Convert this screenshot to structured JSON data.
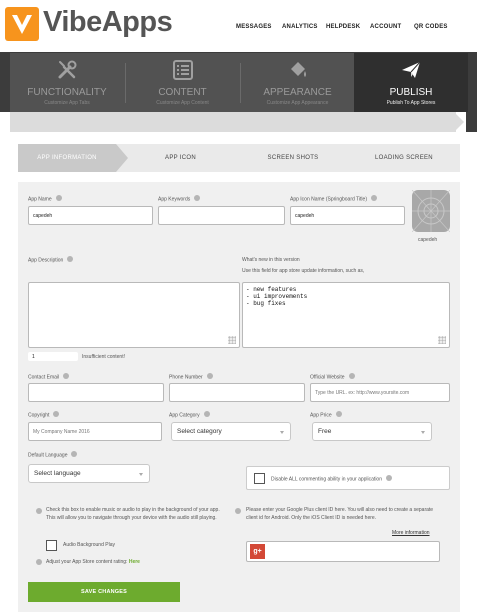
{
  "brand": {
    "name": "VibeApps",
    "logo_color": "#f7941d"
  },
  "topnav": [
    "MESSAGES",
    "ANALYTICS",
    "HELPDESK",
    "ACCOUNT",
    "QR CODES"
  ],
  "sections": [
    {
      "title": "FUNCTIONALITY",
      "sub": "Customize App Tabs",
      "icon": "tools-icon"
    },
    {
      "title": "CONTENT",
      "sub": "Customize App Content",
      "icon": "list-icon"
    },
    {
      "title": "APPEARANCE",
      "sub": "Customize App Appearance",
      "icon": "paint-bucket-icon"
    },
    {
      "title": "PUBLISH",
      "sub": "Publish To App Stores",
      "icon": "paper-plane-icon",
      "active": true
    }
  ],
  "steps": [
    "APP INFORMATION",
    "APP ICON",
    "SCREEN SHOTS",
    "LOADING SCREEN"
  ],
  "form": {
    "app_name_label": "App Name",
    "app_name_value": "capedeh",
    "app_keywords_label": "App Keywords",
    "app_keywords_value": "",
    "icon_name_label": "App Icon Name (Springboard Title)",
    "icon_name_value": "capedeh",
    "icon_caption": "capedeh",
    "description_label": "App Description",
    "whats_new_label": "What's new in this version",
    "whats_new_hint": "Use this field for app store update information, such as,",
    "whats_new_value": "- new features\n- ui improvements\n- bug fixes",
    "char_count": "1",
    "char_status": "Insufficient content!",
    "contact_email_label": "Contact Email",
    "phone_label": "Phone Number",
    "website_label": "Official Website",
    "website_placeholder": "Type the URL. ex: http://www.yoursite.com",
    "copyright_label": "Copyright",
    "copyright_placeholder": "My Company Name 2016",
    "category_label": "App Category",
    "category_value": "Select category",
    "price_label": "App Price",
    "price_value": "Free",
    "language_label": "Default Language",
    "language_value": "Select language",
    "disable_comments_label": "Disable ALL commenting ability in your application",
    "audio_info": "Check this box to enable music or audio to play in the background of your app. This will allow you to navigate through your device with the audio still playing.",
    "audio_label": "Audio Background Play",
    "rating_text": "Adjust your App Store content rating:",
    "rating_link": "Here",
    "gplus_info": "Please enter your Google Plus client ID here. You will also need to create a separate client id for Android. Only the iOS Client ID is needed here.",
    "more_info": "More information",
    "gplus_icon_text": "g+",
    "save_label": "SAVE CHANGES"
  },
  "colors": {
    "accent_green": "#6dab2e",
    "gplus_red": "#d34836",
    "dark": "#3c3c3c"
  }
}
